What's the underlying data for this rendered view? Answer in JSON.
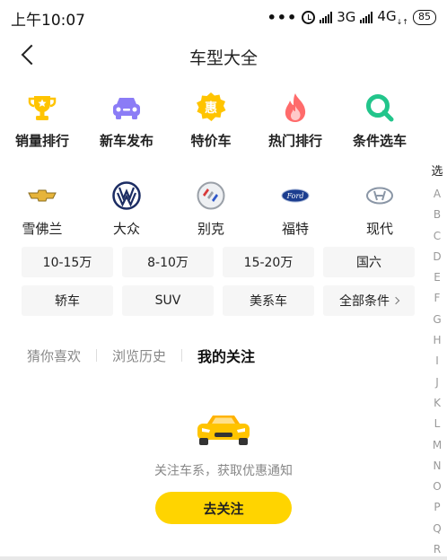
{
  "status_bar": {
    "time": "上午10:07",
    "dots": "•••",
    "net1": "3G",
    "net2": "4G",
    "net2_small": "↓↑",
    "battery": "85"
  },
  "nav": {
    "title": "车型大全"
  },
  "features": [
    {
      "label": "销量排行",
      "icon": "trophy-icon",
      "color": "#ffc400"
    },
    {
      "label": "新车发布",
      "icon": "car-icon",
      "color": "#8b7cf6"
    },
    {
      "label": "特价车",
      "icon": "discount-badge-icon",
      "badge": "惠",
      "color": "#ffc400"
    },
    {
      "label": "热门排行",
      "icon": "flame-icon",
      "color": "#ff6b6b"
    },
    {
      "label": "条件选车",
      "icon": "search-icon",
      "color": "#22c58b"
    }
  ],
  "brands": [
    {
      "label": "雪佛兰",
      "icon": "chevrolet-logo-icon"
    },
    {
      "label": "大众",
      "icon": "volkswagen-logo-icon"
    },
    {
      "label": "别克",
      "icon": "buick-logo-icon"
    },
    {
      "label": "福特",
      "icon": "ford-logo-icon",
      "logo_text": "Ford"
    },
    {
      "label": "现代",
      "icon": "hyundai-logo-icon"
    }
  ],
  "price_chips": [
    "10-15万",
    "8-10万",
    "15-20万",
    "国六"
  ],
  "type_chips": [
    "轿车",
    "SUV",
    "美系车",
    "全部条件"
  ],
  "tabs": [
    "猜你喜欢",
    "浏览历史",
    "我的关注"
  ],
  "active_tab": "我的关注",
  "empty": {
    "text": "关注车系，获取优惠通知",
    "button": "去关注"
  },
  "index_bar": {
    "title": "选",
    "letters": [
      "A",
      "B",
      "C",
      "D",
      "E",
      "F",
      "G",
      "H",
      "I",
      "J",
      "K",
      "L",
      "M",
      "N",
      "O",
      "P",
      "Q",
      "R"
    ]
  },
  "colors": {
    "accent": "#ffd400"
  }
}
